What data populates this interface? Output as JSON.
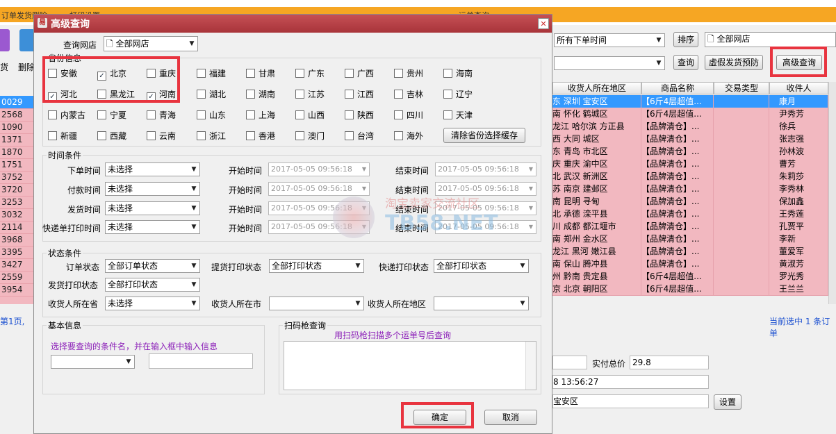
{
  "bg": {
    "tabs": [
      "订单发货删除",
      "打印设置",
      "运单查询"
    ],
    "left_icons": [
      "货",
      "删除"
    ],
    "left_rows": [
      "0029",
      "2568",
      "1090",
      "1371",
      "1870",
      "1751",
      "3752",
      "3720",
      "3253",
      "3032",
      "2114",
      "3968",
      "3395",
      "3427",
      "2559",
      "3954"
    ],
    "pager_text": "第1页,",
    "order_time_select": "所有下单时间",
    "sort_button": "排序",
    "shop_select": "全部网店",
    "query_button": "查询",
    "fake_button": "虚假发货预防",
    "advanced_button": "高级查询",
    "columns": [
      "收货人所在地区",
      "商品名称",
      "交易类型",
      "收件人"
    ],
    "rows": [
      {
        "region": "东 深圳 宝安区",
        "product": "【6斤4层超值...",
        "type": "",
        "receiver": "康月"
      },
      {
        "region": "南 怀化 鹤城区",
        "product": "【6斤4层超值...",
        "type": "",
        "receiver": "尹秀芳"
      },
      {
        "region": "龙江 哈尔滨 方正县",
        "product": "【品牌清仓】...",
        "type": "",
        "receiver": "徐兵"
      },
      {
        "region": "西 大同 城区",
        "product": "【品牌清仓】...",
        "type": "",
        "receiver": "张志强"
      },
      {
        "region": "东 青岛 市北区",
        "product": "【品牌清仓】...",
        "type": "",
        "receiver": "孙林波"
      },
      {
        "region": "庆 重庆 渝中区",
        "product": "【品牌清仓】...",
        "type": "",
        "receiver": "曹芳"
      },
      {
        "region": "北 武汉 新洲区",
        "product": "【品牌清仓】...",
        "type": "",
        "receiver": "朱莉莎"
      },
      {
        "region": "苏 南京 建邺区",
        "product": "【品牌清仓】...",
        "type": "",
        "receiver": "李秀林"
      },
      {
        "region": "南 昆明 寻甸",
        "product": "【品牌清仓】...",
        "type": "",
        "receiver": "保加鑫"
      },
      {
        "region": "北 承德 滦平县",
        "product": "【品牌清仓】...",
        "type": "",
        "receiver": "王秀莲"
      },
      {
        "region": "川 成都 都江堰市",
        "product": "【品牌清仓】...",
        "type": "",
        "receiver": "孔贾平"
      },
      {
        "region": "南 郑州 金水区",
        "product": "【品牌清仓】...",
        "type": "",
        "receiver": "李新"
      },
      {
        "region": "龙江 黑河 嫩江县",
        "product": "【品牌清仓】...",
        "type": "",
        "receiver": "董爱军"
      },
      {
        "region": "南 保山 腾冲县",
        "product": "【品牌清仓】...",
        "type": "",
        "receiver": "黄淑芳"
      },
      {
        "region": "州 黔南 贵定县",
        "product": "【6斤4层超值...",
        "type": "",
        "receiver": "罗光秀"
      },
      {
        "region": "京 北京 朝阳区",
        "product": "【6斤4层超值...",
        "type": "",
        "receiver": "王兰兰"
      }
    ],
    "selected_status": "当前选中 1 条订单",
    "total_label": "实付总价",
    "total_value": "29.8",
    "time_value": "8 13:56:27",
    "area_value": "宝安区",
    "settings_button": "设置"
  },
  "dialog": {
    "title": "高级查询",
    "shop_label": "查询网店",
    "shop_value": "全部网店",
    "province_group": "省份信息",
    "provinces": [
      {
        "name": "安徽",
        "checked": false
      },
      {
        "name": "北京",
        "checked": true
      },
      {
        "name": "重庆",
        "checked": false
      },
      {
        "name": "福建",
        "checked": false
      },
      {
        "name": "甘肃",
        "checked": false
      },
      {
        "name": "广东",
        "checked": false
      },
      {
        "name": "广西",
        "checked": false
      },
      {
        "name": "贵州",
        "checked": false
      },
      {
        "name": "海南",
        "checked": false
      },
      {
        "name": "河北",
        "checked": true
      },
      {
        "name": "黑龙江",
        "checked": false
      },
      {
        "name": "河南",
        "checked": true
      },
      {
        "name": "湖北",
        "checked": false
      },
      {
        "name": "湖南",
        "checked": false
      },
      {
        "name": "江苏",
        "checked": false
      },
      {
        "name": "江西",
        "checked": false
      },
      {
        "name": "吉林",
        "checked": false
      },
      {
        "name": "辽宁",
        "checked": false
      },
      {
        "name": "内蒙古",
        "checked": false
      },
      {
        "name": "宁夏",
        "checked": false
      },
      {
        "name": "青海",
        "checked": false
      },
      {
        "name": "山东",
        "checked": false
      },
      {
        "name": "上海",
        "checked": false
      },
      {
        "name": "山西",
        "checked": false
      },
      {
        "name": "陕西",
        "checked": false
      },
      {
        "name": "四川",
        "checked": false
      },
      {
        "name": "天津",
        "checked": false
      },
      {
        "name": "新疆",
        "checked": false
      },
      {
        "name": "西藏",
        "checked": false
      },
      {
        "name": "云南",
        "checked": false
      },
      {
        "name": "浙江",
        "checked": false
      },
      {
        "name": "香港",
        "checked": false
      },
      {
        "name": "澳门",
        "checked": false
      },
      {
        "name": "台湾",
        "checked": false
      },
      {
        "name": "海外",
        "checked": false
      }
    ],
    "clear_province_button": "清除省份选择缓存",
    "time_group": "时间条件",
    "time_rows": [
      {
        "label": "下单时间",
        "value": "未选择"
      },
      {
        "label": "付款时间",
        "value": "未选择"
      },
      {
        "label": "发货时间",
        "value": "未选择"
      },
      {
        "label": "快递单打印时间",
        "value": "未选择"
      }
    ],
    "start_label": "开始时间",
    "end_label": "结束时间",
    "date_value": "2017-05-05 09:56:18",
    "status_group": "状态条件",
    "order_status_label": "订单状态",
    "order_status_value": "全部订单状态",
    "pick_print_label": "提货打印状态",
    "pick_print_value": "全部打印状态",
    "express_print_label": "快递打印状态",
    "express_print_value": "全部打印状态",
    "ship_print_label": "发货打印状态",
    "ship_print_value": "全部打印状态",
    "province_label": "收货人所在省",
    "province_value": "未选择",
    "city_label": "收货人所在市",
    "city_value": "",
    "district_label": "收货人所在地区",
    "district_value": "",
    "basic_group": "基本信息",
    "basic_hint": "选择要查询的条件名，并在输入框中输入信息",
    "scan_group": "扫码枪查询",
    "scan_hint": "用扫码枪扫描多个运单号后查询",
    "ok_button": "确定",
    "cancel_button": "取消"
  },
  "watermark": {
    "cn": "淘宝卖家交流社区",
    "en": "TB58.NET"
  },
  "colors": {
    "highlight_red": "#e8343f",
    "title_bar": "#b43c42",
    "row_pink": "#f2b8c0",
    "row_selected": "#3399ff",
    "hint_purple": "#8b1fb8"
  }
}
